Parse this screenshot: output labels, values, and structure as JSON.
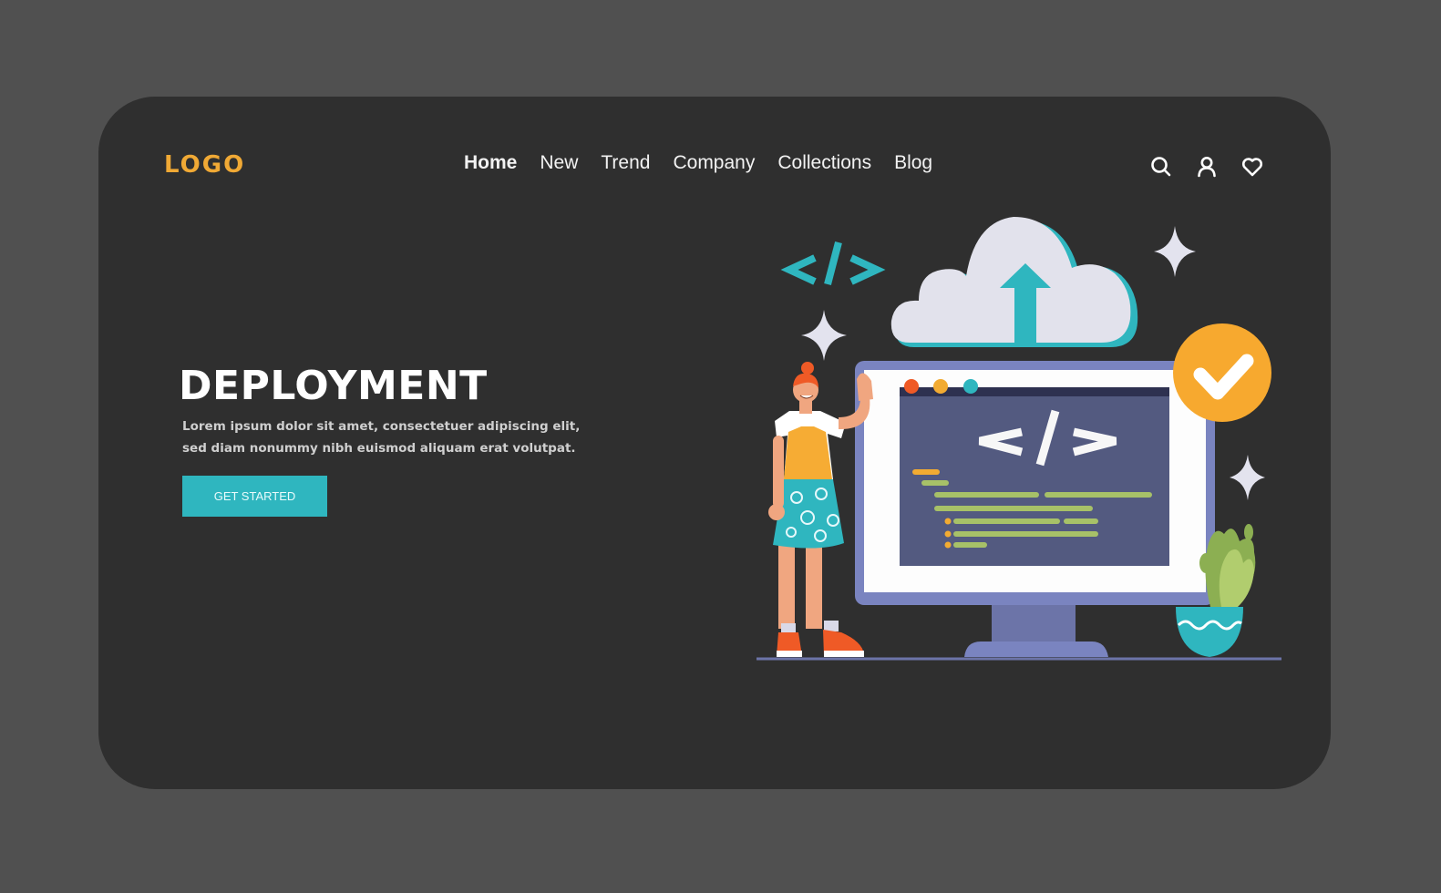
{
  "header": {
    "logo": "LOGO",
    "nav": [
      {
        "label": "Home",
        "active": true
      },
      {
        "label": "New",
        "active": false
      },
      {
        "label": "Trend",
        "active": false
      },
      {
        "label": "Company",
        "active": false
      },
      {
        "label": "Collections",
        "active": false
      },
      {
        "label": "Blog",
        "active": false
      }
    ],
    "icons": [
      "search-icon",
      "user-icon",
      "heart-icon"
    ]
  },
  "hero": {
    "title": "DEPLOYMENT",
    "text": "Lorem ipsum dolor sit amet, consectetuer adipiscing elit, sed diam nonummy nibh euismod aliquam erat volutpat.",
    "cta_label": "GET STARTED"
  },
  "illustration": {
    "code_symbol": "</>",
    "elements": [
      "cloud-upload-icon",
      "monitor",
      "code-window",
      "checkmark-badge",
      "person-waving",
      "potted-plant",
      "sparkles"
    ]
  },
  "colors": {
    "page_bg": "#505050",
    "card_bg": "#2f2f2f",
    "logo": "#f0a935",
    "accent_teal": "#2fb6bf",
    "check_badge": "#f7a92f",
    "monitor_frame": "#7a84c0",
    "screen": "#535a80"
  }
}
